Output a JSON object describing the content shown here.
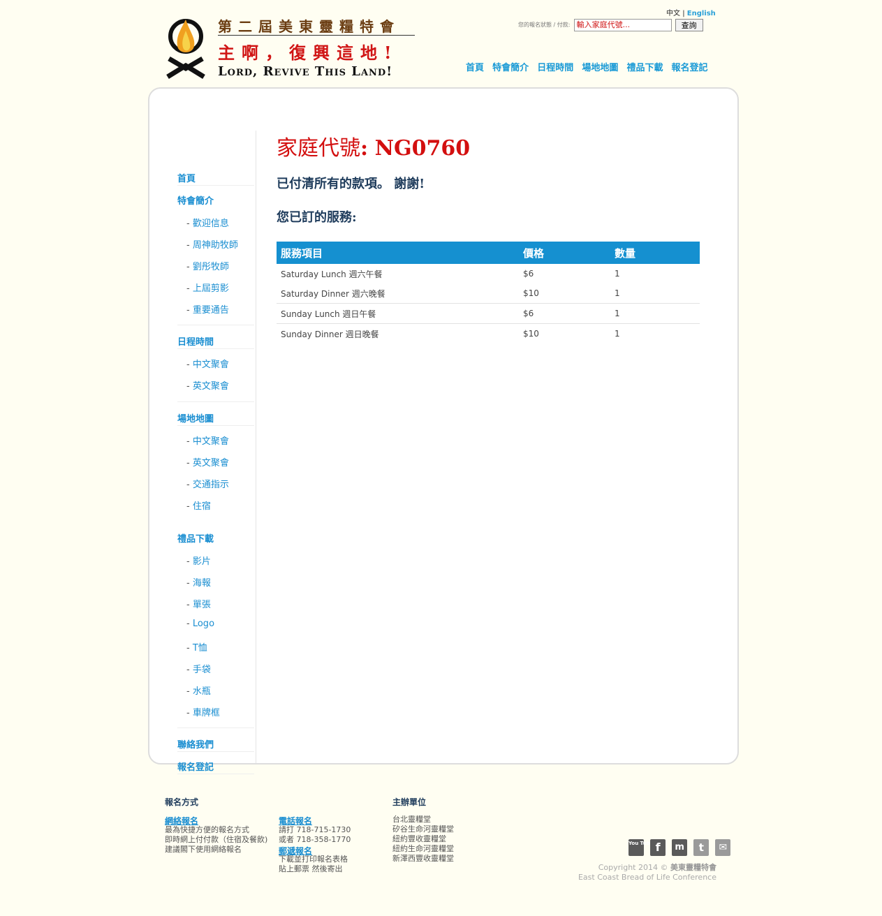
{
  "header": {
    "logo_title": "第二屆美東靈糧特會",
    "logo_slogan_cn": "主啊，復興這地!",
    "logo_slogan_en": "Lord, Revive This Land!",
    "lang_cn": "中文",
    "lang_sep": "|",
    "lang_en": "English",
    "search_label": "您的報名狀態 / 付款:",
    "search_placeholder": "輸入家庭代號...",
    "search_button": "查詢",
    "nav": [
      "首頁",
      "特會簡介",
      "日程時間",
      "場地地圖",
      "禮品下載",
      "報名登記"
    ]
  },
  "sidebar": {
    "home": "首頁",
    "intro": {
      "title": "特會簡介",
      "items": [
        "歡迎信息",
        "周神助牧師",
        "劉彤牧師",
        "上屆剪影",
        "重要通告"
      ]
    },
    "schedule": {
      "title": "日程時間",
      "items": [
        "中文聚會",
        "英文聚會"
      ]
    },
    "venue": {
      "title": "場地地圖",
      "items": [
        "中文聚會",
        "英文聚會",
        "交通指示",
        "住宿"
      ]
    },
    "gifts": {
      "title": "禮品下載",
      "items": [
        "影片",
        "海報",
        "單張",
        "Logo",
        "T恤",
        "手袋",
        "水瓶",
        "車牌框"
      ]
    },
    "contact": "聯絡我們",
    "register": "報名登記",
    "dash": "-"
  },
  "content": {
    "family_code_label": "家庭代號",
    "family_code_colon": ":",
    "family_code": "NG0760",
    "paid_message": "已付清所有的款項。 謝謝!",
    "services_title": "您已訂的服務:",
    "table": {
      "headers": [
        "服務項目",
        "價格",
        "數量"
      ],
      "rows": [
        [
          "Saturday Lunch 週六午餐",
          "$6",
          "1"
        ],
        [
          "Saturday Dinner 週六晚餐",
          "$10",
          "1"
        ],
        [
          "Sunday Lunch 週日午餐",
          "$6",
          "1"
        ],
        [
          "Sunday Dinner 週日晚餐",
          "$10",
          "1"
        ]
      ]
    }
  },
  "footer": {
    "reg_title": "報名方式",
    "online_link": "網絡報名",
    "online_lines": [
      "最為快捷方便的報名方式",
      "即時網上付付款（住宿及餐飲)",
      "建議閣下使用網絡報名"
    ],
    "phone_link": "電話報名",
    "phone_lines": [
      "請打 718-715-1730",
      "或者 718-358-1770"
    ],
    "mail_link": "郵遞報名",
    "mail_lines": [
      "下載並打印報名表格",
      "貼上郵票 然後寄出"
    ],
    "host_title": "主辦單位",
    "host_lines": [
      "台北靈糧堂",
      "矽谷生命河靈糧堂",
      "紐約豐收靈糧堂",
      "紐約生命河靈糧堂",
      "新澤西豐收靈糧堂"
    ],
    "social": [
      "You Tube",
      "f",
      "m",
      "t",
      "✉"
    ],
    "copyright_prefix": "Copyright 2014 ©",
    "copyright_brand": "美東靈糧特會",
    "copyright_en": "East Coast Bread of Life Conference"
  }
}
